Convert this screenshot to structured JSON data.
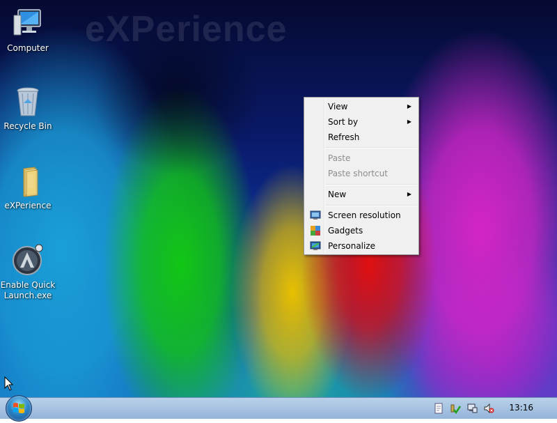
{
  "desktop": {
    "watermark": "eXPerience",
    "icons": [
      {
        "label": "Computer",
        "icon": "computer-icon"
      },
      {
        "label": "Recycle Bin",
        "icon": "recycle-bin-icon"
      },
      {
        "label": "eXPerience",
        "icon": "folder-icon"
      },
      {
        "label_line1": "Enable Quick",
        "label_line2": "Launch.exe",
        "icon": "executable-icon"
      }
    ]
  },
  "context_menu": {
    "items": [
      {
        "label": "View",
        "has_submenu": true,
        "enabled": true
      },
      {
        "label": "Sort by",
        "has_submenu": true,
        "enabled": true
      },
      {
        "label": "Refresh",
        "enabled": true
      },
      {
        "label": "Paste",
        "enabled": false
      },
      {
        "label": "Paste shortcut",
        "enabled": false
      },
      {
        "label": "New",
        "has_submenu": true,
        "enabled": true
      },
      {
        "label": "Screen resolution",
        "icon": "display-icon",
        "enabled": true
      },
      {
        "label": "Gadgets",
        "icon": "gadgets-icon",
        "enabled": true
      },
      {
        "label": "Personalize",
        "icon": "personalize-icon",
        "enabled": true
      }
    ]
  },
  "taskbar": {
    "clock": "13:16",
    "tray_icons": [
      "notes-icon",
      "action-center-icon",
      "network-icon",
      "volume-muted-icon"
    ]
  },
  "colors": {
    "menu_bg": "#f0f0f0",
    "taskbar": "#a9c4e2",
    "disabled_text": "#8d8d8d"
  }
}
